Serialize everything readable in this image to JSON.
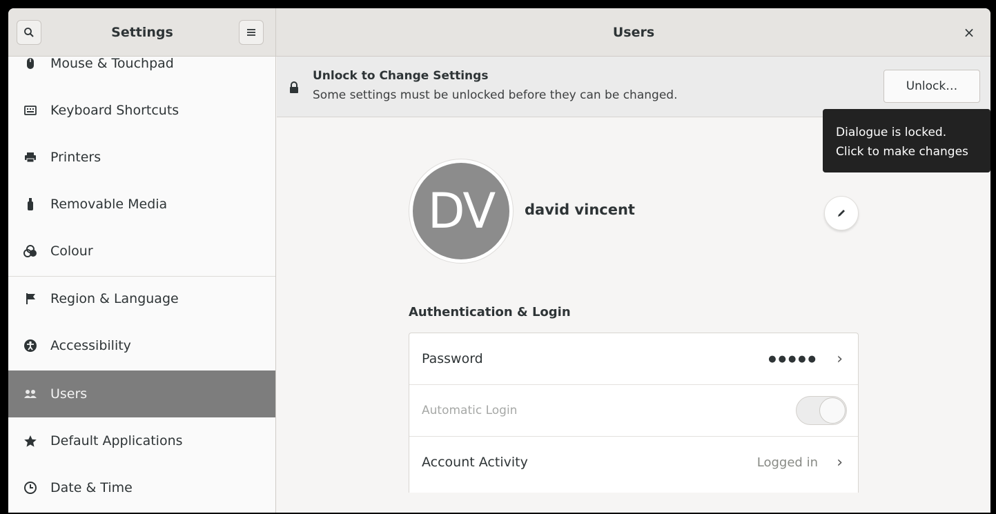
{
  "header": {
    "sidebar_title": "Settings",
    "page_title": "Users",
    "close_glyph": "×"
  },
  "icons": {
    "search": "search-icon",
    "menu": "hamburger-menu-icon",
    "close": "close-icon",
    "lock": "lock-icon",
    "edit": "pencil-icon",
    "chevron": "chevron-right-icon"
  },
  "sidebar": {
    "items": [
      {
        "label": "Mouse & Touchpad",
        "icon": "mouse-icon"
      },
      {
        "label": "Keyboard Shortcuts",
        "icon": "keyboard-icon"
      },
      {
        "label": "Printers",
        "icon": "printer-icon"
      },
      {
        "label": "Removable Media",
        "icon": "usb-icon"
      },
      {
        "label": "Colour",
        "icon": "colour-icon"
      },
      {
        "label": "Region & Language",
        "icon": "flag-icon"
      },
      {
        "label": "Accessibility",
        "icon": "accessibility-icon"
      },
      {
        "label": "Users",
        "icon": "users-icon",
        "selected": true
      },
      {
        "label": "Default Applications",
        "icon": "star-icon"
      },
      {
        "label": "Date & Time",
        "icon": "clock-icon"
      }
    ]
  },
  "banner": {
    "title": "Unlock to Change Settings",
    "subtitle": "Some settings must be unlocked before they can be changed.",
    "unlock_label": "Unlock…"
  },
  "tooltip": {
    "line1": "Dialogue is locked.",
    "line2": "Click to make changes"
  },
  "user": {
    "initials": "DV",
    "name": "david vincent"
  },
  "auth": {
    "section_title": "Authentication & Login",
    "password_label": "Password",
    "password_value": "●●●●●",
    "autologin_label": "Automatic Login",
    "autologin_enabled": false,
    "activity_label": "Account Activity",
    "activity_value": "Logged in"
  },
  "colors": {
    "selected_row": "#7d7d7d",
    "avatar_bg": "#8c8c8c",
    "tooltip_bg": "#222222"
  }
}
